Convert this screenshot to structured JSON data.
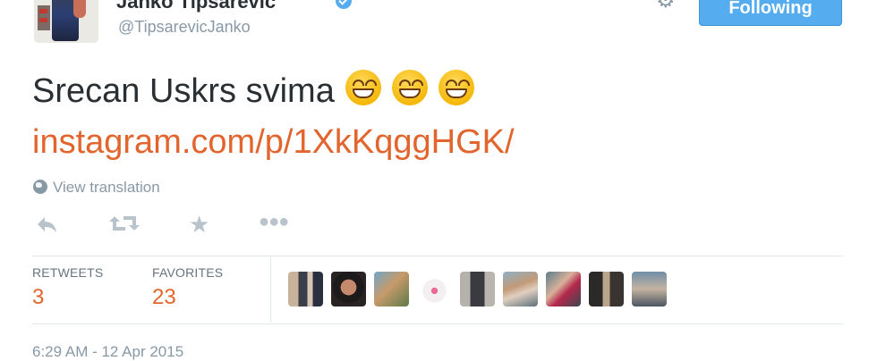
{
  "profile": {
    "name": "Janko Tipsarevic",
    "handle": "@TipsarevicJanko",
    "verified": true
  },
  "header": {
    "follow_button_label": "Following"
  },
  "tweet": {
    "text": "Srecan Uskrs svima",
    "emojis": [
      "grinning-face",
      "grinning-face",
      "grinning-face"
    ],
    "link": "instagram.com/p/1XkKqggHGK/",
    "translation_label": "View translation"
  },
  "actions": [
    "reply-icon",
    "retweet-icon",
    "favorite-icon",
    "more-icon"
  ],
  "stats": {
    "retweets_label": "RETWEETS",
    "retweets_count": "3",
    "favorites_label": "FAVORITES",
    "favorites_count": "23"
  },
  "timestamp": "6:29 AM - 12 Apr 2015",
  "colors": {
    "link": "#e1652c",
    "accent": "#55acee",
    "muted": "#8899a6"
  }
}
